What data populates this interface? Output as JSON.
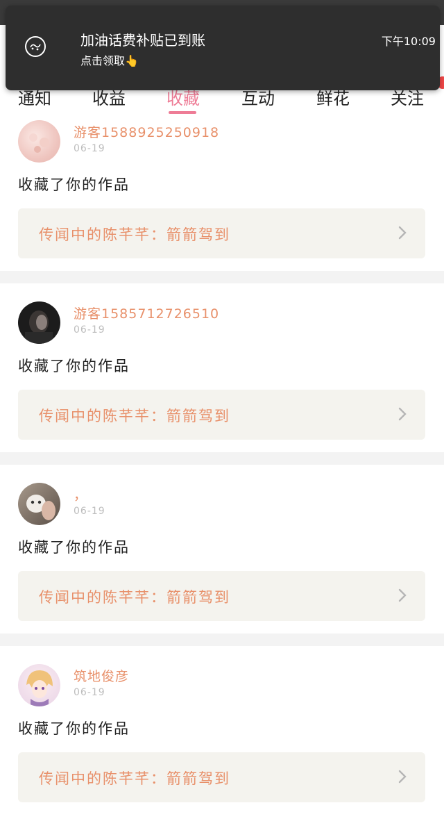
{
  "notification": {
    "title": "加油话费补贴已到账",
    "subtitle": "点击领取👆",
    "time": "下午10:09"
  },
  "tabs": [
    {
      "label": "通知",
      "active": false
    },
    {
      "label": "收益",
      "active": false
    },
    {
      "label": "收藏",
      "active": true
    },
    {
      "label": "互动",
      "active": false
    },
    {
      "label": "鲜花",
      "active": false
    },
    {
      "label": "关注",
      "active": false
    }
  ],
  "colors": {
    "accent": "#ee7c96",
    "username": "#e8906a",
    "badge": "#f24747",
    "card_bg": "#f4f3ee"
  },
  "items": [
    {
      "username": "游客1588925250918",
      "date": "06-19",
      "action": "收藏了你的作品",
      "work": "传闻中的陈芊芊：箭箭驾到"
    },
    {
      "username": "游客1585712726510",
      "date": "06-19",
      "action": "收藏了你的作品",
      "work": "传闻中的陈芊芊：箭箭驾到"
    },
    {
      "username": "，",
      "date": "06-19",
      "action": "收藏了你的作品",
      "work": "传闻中的陈芊芊：箭箭驾到"
    },
    {
      "username": "筑地俊彦",
      "date": "06-19",
      "action": "收藏了你的作品",
      "work": "传闻中的陈芊芊：箭箭驾到"
    }
  ]
}
